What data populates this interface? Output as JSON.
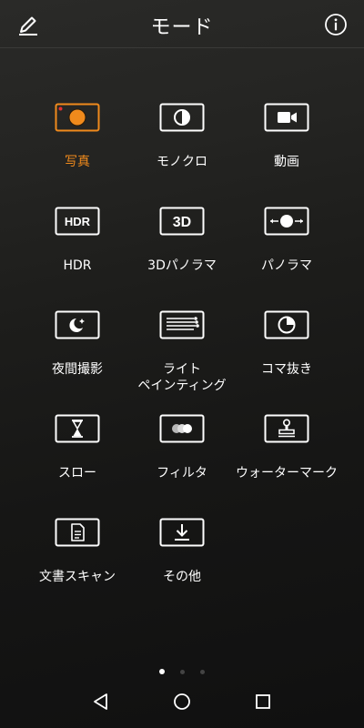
{
  "header": {
    "title": "モード"
  },
  "modes": [
    {
      "label": "写真",
      "icon": "camera-photo-icon",
      "active": true
    },
    {
      "label": "モノクロ",
      "icon": "monochrome-icon",
      "active": false
    },
    {
      "label": "動画",
      "icon": "video-camera-icon",
      "active": false
    },
    {
      "label": "HDR",
      "icon": "hdr-icon",
      "active": false
    },
    {
      "label": "3Dパノラマ",
      "icon": "3d-panorama-icon",
      "active": false
    },
    {
      "label": "パノラマ",
      "icon": "panorama-icon",
      "active": false
    },
    {
      "label": "夜間撮影",
      "icon": "night-moon-icon",
      "active": false
    },
    {
      "label": "ライト\nペインティング",
      "icon": "light-painting-icon",
      "active": false
    },
    {
      "label": "コマ抜き",
      "icon": "time-lapse-icon",
      "active": false
    },
    {
      "label": "スロー",
      "icon": "hourglass-icon",
      "active": false
    },
    {
      "label": "フィルタ",
      "icon": "filter-icon",
      "active": false
    },
    {
      "label": "ウォーターマーク",
      "icon": "stamp-icon",
      "active": false
    },
    {
      "label": "文書スキャン",
      "icon": "document-icon",
      "active": false
    },
    {
      "label": "その他",
      "icon": "download-icon",
      "active": false
    }
  ],
  "icon_text": {
    "hdr": "HDR",
    "three_d": "3D"
  },
  "colors": {
    "accent": "#f08a1c"
  }
}
